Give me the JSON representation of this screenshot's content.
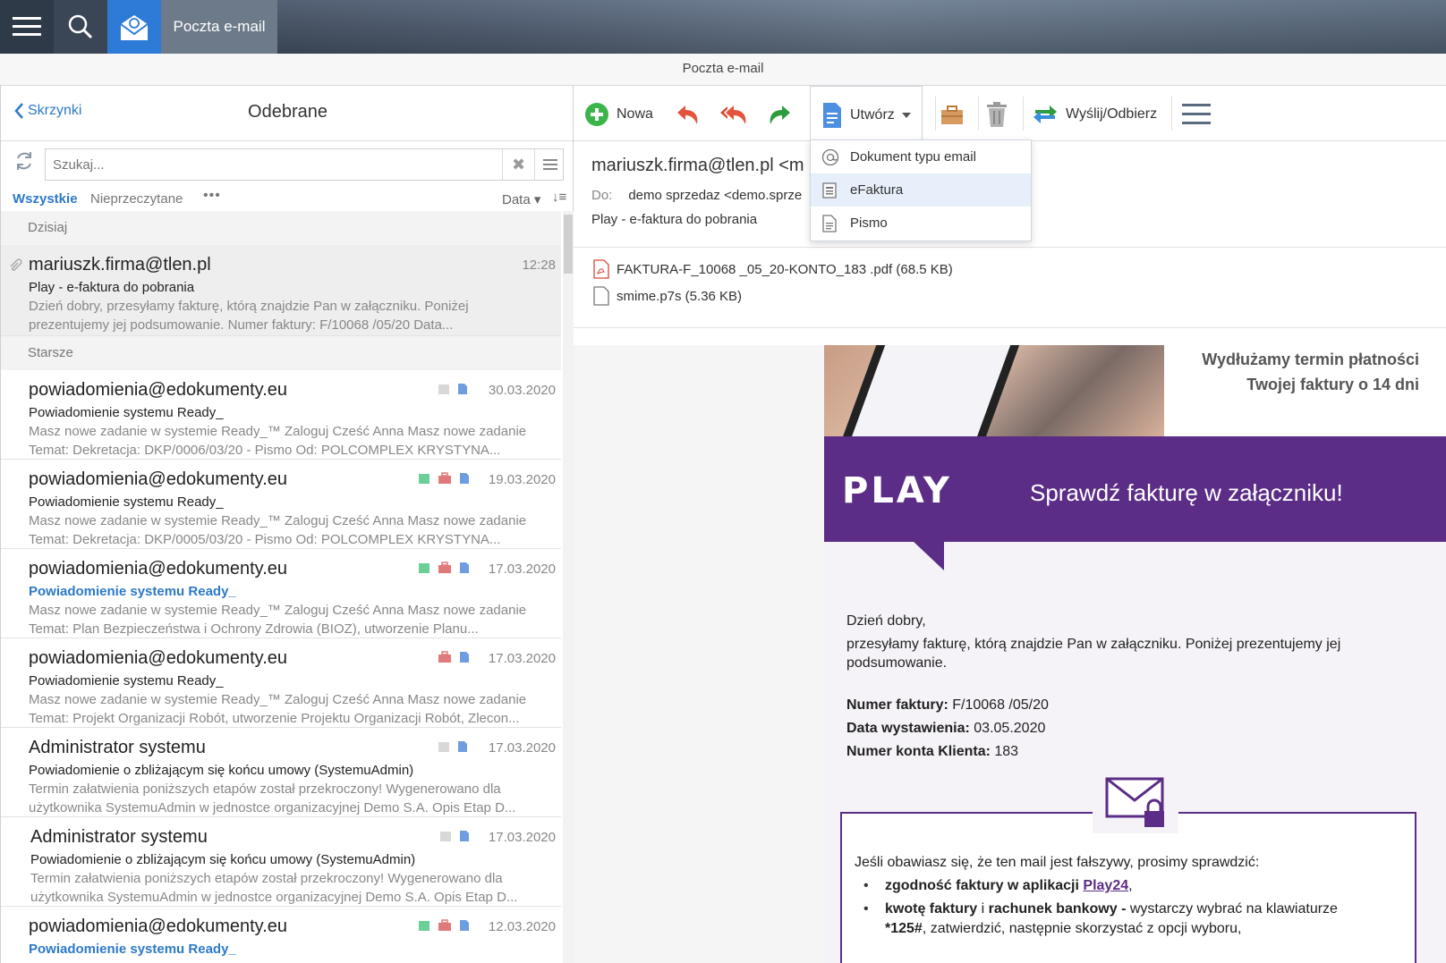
{
  "window": {
    "app_title": "Poczta e-mail",
    "center_title": "Poczta e-mail"
  },
  "left": {
    "back_label": "Skrzynki",
    "folder_title": "Odebrane",
    "search_placeholder": "Szukaj...",
    "filter_all": "Wszystkie",
    "filter_unread": "Nieprzeczytane",
    "filter_more": "•••",
    "sort_label": "Data",
    "groups": [
      "Dzisiaj",
      "Starsze"
    ],
    "messages": [
      {
        "from": "mariuszk.firma@tlen.pl",
        "subject": "Play - e-faktura do pobrania",
        "preview1": "Dzień dobry, przesyłamy fakturę, którą znajdzie Pan w załączniku. Poniżej",
        "preview2": "prezentujemy jej podsumowanie. Numer faktury: F/10068      /05/20 Data...",
        "date": "12:28"
      },
      {
        "from": "powiadomienia@edokumenty.eu",
        "subject": "Powiadomienie systemu Ready_",
        "preview1": "Masz nowe zadanie w systemie Ready_™ Zaloguj Cześć Anna Masz nowe zadanie",
        "preview2": "Temat: Dekretacja: DKP/0006/03/20 - Pismo Od: POLCOMPLEX KRYSTYNA...",
        "date": "30.03.2020"
      },
      {
        "from": "powiadomienia@edokumenty.eu",
        "subject": "Powiadomienie systemu Ready_",
        "preview1": "Masz nowe zadanie w systemie Ready_™ Zaloguj Cześć Anna Masz nowe zadanie",
        "preview2": "Temat: Dekretacja: DKP/0005/03/20 - Pismo Od: POLCOMPLEX KRYSTYNA...",
        "date": "19.03.2020"
      },
      {
        "from": "powiadomienia@edokumenty.eu",
        "subject": "Powiadomienie systemu Ready_",
        "preview1": "Masz nowe zadanie w systemie Ready_™ Zaloguj Cześć Anna Masz nowe zadanie",
        "preview2": "Temat: Plan Bezpieczeństwa i Ochrony Zdrowia (BIOZ), utworzenie Planu...",
        "date": "17.03.2020"
      },
      {
        "from": "powiadomienia@edokumenty.eu",
        "subject": "Powiadomienie systemu Ready_",
        "preview1": "Masz nowe zadanie w systemie Ready_™ Zaloguj Cześć Anna Masz nowe zadanie",
        "preview2": "Temat: Projekt Organizacji Robót, utworzenie Projektu Organizacji Robót, Zlecon...",
        "date": "17.03.2020"
      },
      {
        "from": "Administrator systemu",
        "subject": "Powiadomienie o zbliżającym się końcu umowy (SystemuAdmin)",
        "preview1": "Termin załatwienia poniższych etapów został przekroczony! Wygenerowano dla",
        "preview2": "użytkownika SystemuAdmin w jednostce organizacyjnej Demo S.A. Opis Etap D...",
        "date": "17.03.2020"
      },
      {
        "from": "Administrator systemu",
        "subject": "Powiadomienie o zbliżającym się końcu umowy (SystemuAdmin)",
        "preview1": "Termin załatwienia poniższych etapów został przekroczony! Wygenerowano dla",
        "preview2": "użytkownika SystemuAdmin w jednostce organizacyjnej Demo S.A. Opis Etap D...",
        "date": "17.03.2020"
      },
      {
        "from": "powiadomienia@edokumenty.eu",
        "subject": "Powiadomienie systemu Ready_",
        "preview1": "",
        "preview2": "",
        "date": "12.03.2020"
      }
    ]
  },
  "toolbar": {
    "new_label": "Nowa",
    "create_label": "Utwórz",
    "send_receive_label": "Wyślij/Odbierz"
  },
  "dropdown": {
    "items": [
      "Dokument typu email",
      "eFaktura",
      "Pismo"
    ]
  },
  "reader": {
    "from": "mariuszk.firma@tlen.pl <m",
    "to_label": "Do:",
    "to_value": "demo sprzedaz <demo.sprze",
    "subject": "Play - e-faktura do pobrania",
    "attachments": [
      "FAKTURA-F_10068        _05_20-KONTO_183         .pdf (68.5 KB)",
      "smime.p7s (5.36 KB)"
    ]
  },
  "email": {
    "hero_line1": "Wydłużamy termin płatności",
    "hero_line2": "Twojej faktury o 14 dni",
    "logo": "PLAY",
    "banner_text": "Sprawdź fakturę w załączniku!",
    "greeting": "Dzień dobry,",
    "intro1": "przesyłamy fakturę, którą znajdzie Pan w załączniku. Poniżej prezentujemy jej",
    "intro2": "podsumowanie.",
    "invoice_label": "Numer faktury:",
    "invoice_value": "F/10068       /05/20",
    "date_label": "Data wystawienia:",
    "date_value": "03.05.2020",
    "account_label": "Numer konta Klienta:",
    "account_value": "183",
    "warning": "Jeśli obawiasz się, że ten mail jest fałszywy, prosimy sprawdzić:",
    "b1_strong": "zgodność faktury w aplikacji",
    "b1_link": "Play24",
    "b1_end": ",",
    "b2_strong1": "kwotę faktury",
    "b2_mid": " i ",
    "b2_strong2": "rachunek bankowy -",
    "b2_rest": " wystarczy wybrać na klawiaturze",
    "b3_strong": "*125#",
    "b3_rest": ", zatwierdzić, następnie skorzystać z opcji wyboru,"
  },
  "colors": {
    "accent": "#2d79c7",
    "play_purple": "#5b2d86"
  }
}
